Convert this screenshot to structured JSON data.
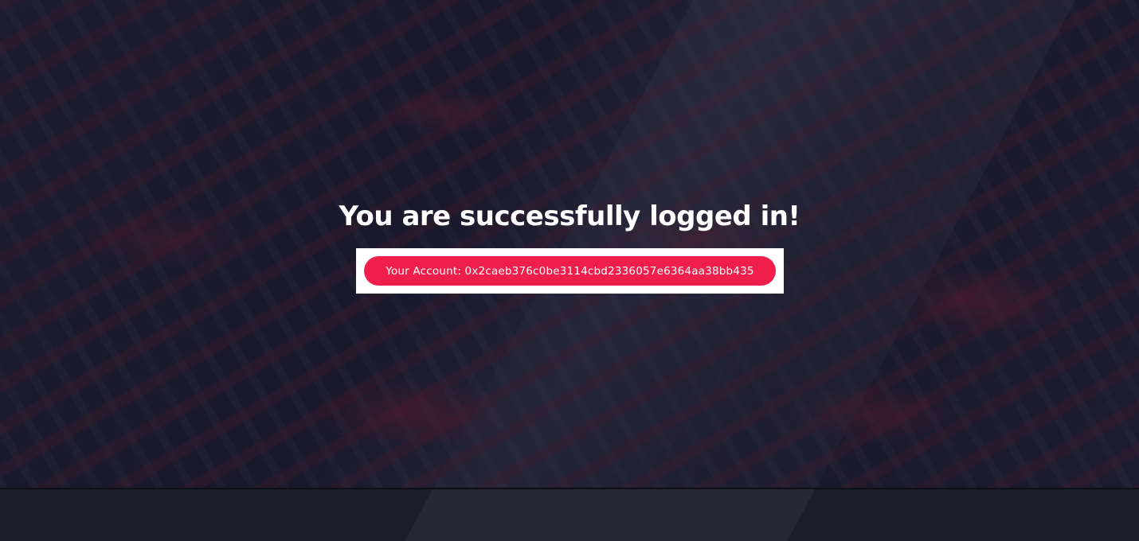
{
  "hero": {
    "title": "You are successfully logged in!",
    "account_label": "Your Account: 0x2caeb376c0be3114cbd2336057e6364aa38bb435"
  },
  "colors": {
    "accent": "#f01e4b",
    "overlay": "#121228",
    "text": "#ffffff",
    "box": "#ffffff"
  }
}
